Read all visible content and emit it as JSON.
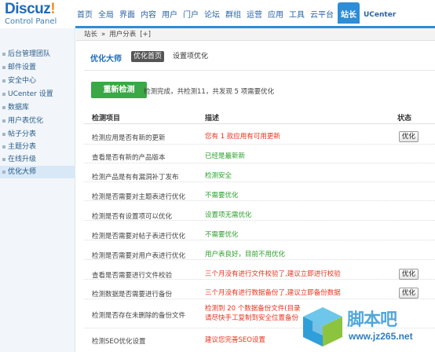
{
  "header": {
    "logo": "Discuz",
    "logo_bang": "!",
    "logo_sub": "Control Panel",
    "nav": [
      "首页",
      "全局",
      "界面",
      "内容",
      "用户",
      "门户",
      "论坛",
      "群组",
      "运营",
      "应用",
      "工具",
      "云平台",
      "站长",
      "UCenter"
    ],
    "active_nav": "站长"
  },
  "sidebar": {
    "items": [
      "后台管理团队",
      "邮件设置",
      "安全中心",
      "UCenter 设置",
      "数据库",
      "用户表优化",
      "帖子分表",
      "主题分表",
      "在线升级",
      "优化大师"
    ],
    "active": "优化大师"
  },
  "breadcrumb": {
    "parts": [
      "站长",
      "»",
      "用户分表",
      "[+]"
    ]
  },
  "main": {
    "title": "优化大师",
    "tab_active": "优化首页",
    "tab_other": "设置项优化",
    "recheck_label": "重新检测",
    "summary": "检测完成，共检测11，共发现 5 项需要优化",
    "headers": {
      "item": "检测项目",
      "desc": "描述",
      "status": "状态"
    },
    "rows": [
      {
        "item": "检测应用是否有新的更新",
        "desc": "您有 1 款应用有可用更新",
        "desc2": "",
        "level": "red",
        "action": "优化"
      },
      {
        "item": "查看是否有新的产品版本",
        "desc": "已经是最新新",
        "desc2": "",
        "level": "green",
        "action": ""
      },
      {
        "item": "检测产品是有有漏洞补丁发布",
        "desc": "检测安全",
        "desc2": "",
        "level": "green",
        "action": ""
      },
      {
        "item": "检测是否需要对主题表进行优化",
        "desc": "不需要优化",
        "desc2": "",
        "level": "green",
        "action": ""
      },
      {
        "item": "检测是否有设置项可以优化",
        "desc": "设置项无需优化",
        "desc2": "",
        "level": "green",
        "action": ""
      },
      {
        "item": "检测是否需要对帖子表进行优化",
        "desc": "不需要优化",
        "desc2": "",
        "level": "green",
        "action": ""
      },
      {
        "item": "检测是否需要对用户表进行优化",
        "desc": "用户表良好，目前不用优化",
        "desc2": "",
        "level": "green",
        "action": ""
      },
      {
        "item": "查看是否需要进行文件校验",
        "desc": "三个月没有进行文件校验了,建议立即进行校验",
        "desc2": "",
        "level": "red",
        "action": "优化"
      },
      {
        "item": "检测数据是否需要进行备份",
        "desc": "三个月没有进行数据备份了,建议立即备份数据",
        "desc2": "",
        "level": "red",
        "action": "优化"
      },
      {
        "item": "检测是否存在未删除的备份文件",
        "desc": "检测到 20 个数据备份文件(目录",
        "desc2": "请尽快手工复制到安全位置备份",
        "level": "red",
        "action": ""
      },
      {
        "item": "检测SEO优化设置",
        "desc": "建议您完善SEO设置",
        "desc2": "",
        "level": "red",
        "action": ""
      }
    ]
  },
  "watermark": {
    "text": "脚本吧",
    "url": "www.jz265.net"
  }
}
